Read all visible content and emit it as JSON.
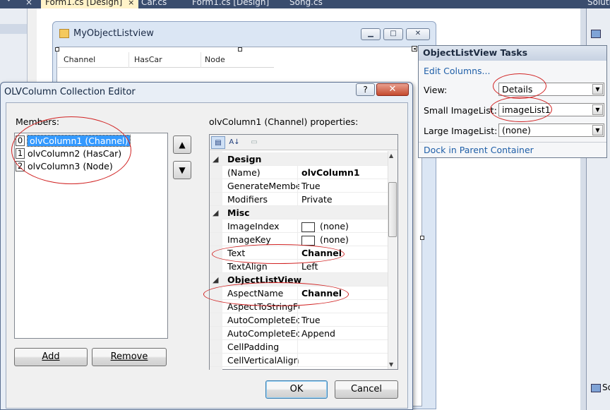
{
  "ide": {
    "tabs": [
      {
        "label": "Form1.cs [Design]",
        "close": "×",
        "active": true
      },
      {
        "label": "Car.cs"
      },
      {
        "label": "Form1.cs [Design]"
      },
      {
        "label": "Song.cs"
      }
    ],
    "left_tab_close": "×",
    "left_tab_pin": "ᐩ",
    "right_tab_label": "Soluti",
    "right_bottom_label": "So"
  },
  "form": {
    "title": "MyObjectListview",
    "min_symbol": "▁",
    "max_symbol": "□",
    "close_symbol": "✕",
    "columns": [
      "Channel",
      "HasCar",
      "Node"
    ],
    "smart_tag_glyph": "◂"
  },
  "tasks": {
    "title": "ObjectListView Tasks",
    "edit_columns": "Edit Columns...",
    "view_label": "View:",
    "view_value": "Details",
    "small_label": "Small ImageList:",
    "small_value": "imageList1",
    "large_label": "Large ImageList:",
    "large_value": "(none)",
    "dock": "Dock in Parent Container",
    "arrow": "▼"
  },
  "dialog": {
    "title": "OLVColumn Collection Editor",
    "help": "?",
    "close": "✕",
    "members_label": "Members:",
    "members": [
      {
        "index": "0",
        "label": "olvColumn1 (Channel)"
      },
      {
        "index": "1",
        "label": "olvColumn2 (HasCar)"
      },
      {
        "index": "2",
        "label": "olvColumn3 (Node)"
      }
    ],
    "up_arrow": "▲",
    "down_arrow": "▼",
    "add": "Add",
    "remove": "Remove",
    "props_label": "olvColumn1 (Channel) properties:",
    "ok": "OK",
    "cancel": "Cancel"
  },
  "properties": {
    "toolbar": [
      "categorized-icon",
      "alphabetical-icon",
      "property-pages-icon"
    ],
    "toolbar_glyphs": [
      "▤",
      "A↓",
      "▭"
    ],
    "collapse_glyph": "◢",
    "rows": [
      {
        "kind": "category",
        "name": "Design"
      },
      {
        "kind": "prop",
        "name": "(Name)",
        "value": "olvColumn1",
        "bold": true
      },
      {
        "kind": "prop",
        "name": "GenerateMembe",
        "value": "True"
      },
      {
        "kind": "prop",
        "name": "Modifiers",
        "value": "Private"
      },
      {
        "kind": "category",
        "name": "Misc"
      },
      {
        "kind": "prop",
        "name": "ImageIndex",
        "value": "(none)",
        "swatch": true
      },
      {
        "kind": "prop",
        "name": "ImageKey",
        "value": "(none)",
        "swatch": true
      },
      {
        "kind": "prop",
        "name": "Text",
        "value": "Channel",
        "bold": true
      },
      {
        "kind": "prop",
        "name": "TextAlign",
        "value": "Left"
      },
      {
        "kind": "category",
        "name": "ObjectListView"
      },
      {
        "kind": "prop",
        "name": "AspectName",
        "value": "Channel",
        "bold": true
      },
      {
        "kind": "prop",
        "name": "AspectToStringFc",
        "value": ""
      },
      {
        "kind": "prop",
        "name": "AutoCompleteEd",
        "value": "True"
      },
      {
        "kind": "prop",
        "name": "AutoCompleteEd",
        "value": "Append"
      },
      {
        "kind": "prop",
        "name": "CellPadding",
        "value": ""
      },
      {
        "kind": "prop",
        "name": "CellVerticalAlignn",
        "value": ""
      }
    ]
  }
}
